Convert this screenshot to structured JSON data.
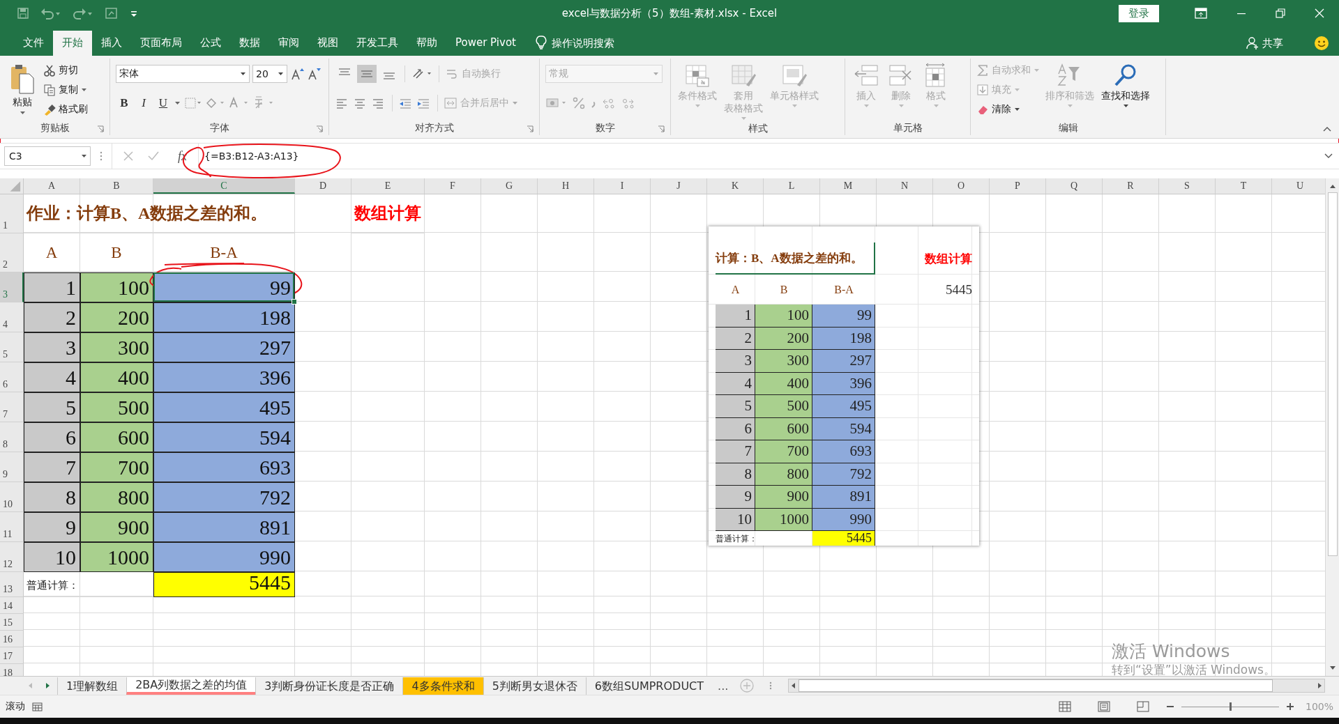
{
  "window": {
    "title": "excel与数据分析（5）数组-素材.xlsx  -  Excel",
    "sign_in": "登录"
  },
  "ribbon_tabs": [
    {
      "label": "文件",
      "selected": false
    },
    {
      "label": "开始",
      "selected": true
    },
    {
      "label": "插入",
      "selected": false
    },
    {
      "label": "页面布局",
      "selected": false
    },
    {
      "label": "公式",
      "selected": false
    },
    {
      "label": "数据",
      "selected": false
    },
    {
      "label": "审阅",
      "selected": false
    },
    {
      "label": "视图",
      "selected": false
    },
    {
      "label": "开发工具",
      "selected": false
    },
    {
      "label": "帮助",
      "selected": false
    },
    {
      "label": "Power Pivot",
      "selected": false
    }
  ],
  "tell_me": "操作说明搜索",
  "share": "共享",
  "ribbon": [
    {
      "kind": "clipboard",
      "label": "剪贴板",
      "paste": "粘贴",
      "commands": [
        {
          "label": "剪切",
          "disabled": false
        },
        {
          "label": "复制",
          "disabled": false
        },
        {
          "label": "格式刷",
          "disabled": false
        }
      ]
    },
    {
      "kind": "font",
      "label": "字体",
      "font_name": "宋体",
      "font_size": "20",
      "style_buttons": [
        {
          "label": "B"
        },
        {
          "label": "I"
        },
        {
          "label": "U"
        }
      ]
    },
    {
      "kind": "alignment",
      "label": "对齐方式",
      "vertical_align": [
        {
          "selected": false
        },
        {
          "selected": true
        },
        {
          "selected": false
        }
      ],
      "commands": [
        {
          "label": "自动换行",
          "disabled": true
        },
        {
          "label": "合并后居中",
          "disabled": true
        }
      ]
    },
    {
      "kind": "number",
      "label": "数字",
      "format": {
        "value": "常规",
        "disabled": true
      }
    },
    {
      "kind": "styles",
      "label": "样式",
      "commands": [
        {
          "label": "条件格式",
          "disabled": true
        },
        {
          "lines": [
            "套用",
            "表格格式"
          ],
          "disabled": true
        },
        {
          "label": "单元格样式",
          "disabled": true
        }
      ]
    },
    {
      "kind": "cells",
      "label": "单元格",
      "commands": [
        {
          "label": "插入",
          "disabled": true
        },
        {
          "label": "删除",
          "disabled": true
        },
        {
          "label": "格式",
          "disabled": true
        }
      ]
    },
    {
      "kind": "editing",
      "label": "编辑",
      "commands": [
        {
          "label": "自动求和",
          "disabled": true
        },
        {
          "label": "填充",
          "disabled": true
        },
        {
          "label": "清除",
          "disabled": false
        },
        {
          "label": "排序和筛选",
          "disabled": true
        },
        {
          "label": "查找和选择",
          "disabled": false
        }
      ]
    }
  ],
  "formula_bar": {
    "name_box": "C3",
    "function_label": "fx",
    "formula": "{=B3:B12-A3:A13}"
  },
  "columns": [
    {
      "label": "A",
      "selected": false
    },
    {
      "label": "B",
      "selected": false
    },
    {
      "label": "C",
      "selected": true
    },
    {
      "label": "D",
      "selected": false
    },
    {
      "label": "E",
      "selected": false
    },
    {
      "label": "F",
      "selected": false
    },
    {
      "label": "G",
      "selected": false
    },
    {
      "label": "H",
      "selected": false
    },
    {
      "label": "I",
      "selected": false
    },
    {
      "label": "J",
      "selected": false
    },
    {
      "label": "K",
      "selected": false
    },
    {
      "label": "L",
      "selected": false
    },
    {
      "label": "M",
      "selected": false
    },
    {
      "label": "N",
      "selected": false
    },
    {
      "label": "O",
      "selected": false
    },
    {
      "label": "P",
      "selected": false
    },
    {
      "label": "Q",
      "selected": false
    },
    {
      "label": "R",
      "selected": false
    },
    {
      "label": "S",
      "selected": false
    },
    {
      "label": "T",
      "selected": false
    },
    {
      "label": "U",
      "selected": false
    }
  ],
  "rows": [
    {
      "number": "1",
      "selected": false,
      "cells": [
        {
          "kind": "title",
          "text": "作业：计算B、A数据之差的和。",
          "selected": false
        },
        {
          "kind": "array-title",
          "text": "数组计算",
          "selected": false
        }
      ]
    },
    {
      "number": "2",
      "selected": false,
      "cells": [
        {
          "kind": "a-header",
          "text": "A",
          "selected": false
        },
        {
          "kind": "b-header",
          "text": "B",
          "selected": false
        },
        {
          "kind": "diff-header",
          "text": "B-A",
          "selected": false
        }
      ]
    },
    {
      "number": "3",
      "selected": true,
      "cells": [
        {
          "kind": "a-value",
          "text": "1",
          "color": "#c9c9c9",
          "selected": false
        },
        {
          "kind": "b-value",
          "text": "100",
          "color": "#a9d08e",
          "selected": false
        },
        {
          "kind": "diff-value",
          "text": "99",
          "color": "#8eaadb",
          "selected": true
        }
      ]
    },
    {
      "number": "4",
      "selected": false,
      "cells": [
        {
          "kind": "a-value",
          "text": "2",
          "color": "#c9c9c9",
          "selected": false
        },
        {
          "kind": "b-value",
          "text": "200",
          "color": "#a9d08e",
          "selected": false
        },
        {
          "kind": "diff-value",
          "text": "198",
          "color": "#8eaadb",
          "selected": false
        }
      ]
    },
    {
      "number": "5",
      "selected": false,
      "cells": [
        {
          "kind": "a-value",
          "text": "3",
          "color": "#c9c9c9",
          "selected": false
        },
        {
          "kind": "b-value",
          "text": "300",
          "color": "#a9d08e",
          "selected": false
        },
        {
          "kind": "diff-value",
          "text": "297",
          "color": "#8eaadb",
          "selected": false
        }
      ]
    },
    {
      "number": "6",
      "selected": false,
      "cells": [
        {
          "kind": "a-value",
          "text": "4",
          "color": "#c9c9c9",
          "selected": false
        },
        {
          "kind": "b-value",
          "text": "400",
          "color": "#a9d08e",
          "selected": false
        },
        {
          "kind": "diff-value",
          "text": "396",
          "color": "#8eaadb",
          "selected": false
        }
      ]
    },
    {
      "number": "7",
      "selected": false,
      "cells": [
        {
          "kind": "a-value",
          "text": "5",
          "color": "#c9c9c9",
          "selected": false
        },
        {
          "kind": "b-value",
          "text": "500",
          "color": "#a9d08e",
          "selected": false
        },
        {
          "kind": "diff-value",
          "text": "495",
          "color": "#8eaadb",
          "selected": false
        }
      ]
    },
    {
      "number": "8",
      "selected": false,
      "cells": [
        {
          "kind": "a-value",
          "text": "6",
          "color": "#c9c9c9",
          "selected": false
        },
        {
          "kind": "b-value",
          "text": "600",
          "color": "#a9d08e",
          "selected": false
        },
        {
          "kind": "diff-value",
          "text": "594",
          "color": "#8eaadb",
          "selected": false
        }
      ]
    },
    {
      "number": "9",
      "selected": false,
      "cells": [
        {
          "kind": "a-value",
          "text": "7",
          "color": "#c9c9c9",
          "selected": false
        },
        {
          "kind": "b-value",
          "text": "700",
          "color": "#a9d08e",
          "selected": false
        },
        {
          "kind": "diff-value",
          "text": "693",
          "color": "#8eaadb",
          "selected": false
        }
      ]
    },
    {
      "number": "10",
      "selected": false,
      "cells": [
        {
          "kind": "a-value",
          "text": "8",
          "color": "#c9c9c9",
          "selected": false
        },
        {
          "kind": "b-value",
          "text": "800",
          "color": "#a9d08e",
          "selected": false
        },
        {
          "kind": "diff-value",
          "text": "792",
          "color": "#8eaadb",
          "selected": false
        }
      ]
    },
    {
      "number": "11",
      "selected": false,
      "cells": [
        {
          "kind": "a-value",
          "text": "9",
          "color": "#c9c9c9",
          "selected": false
        },
        {
          "kind": "b-value",
          "text": "900",
          "color": "#a9d08e",
          "selected": false
        },
        {
          "kind": "diff-value",
          "text": "891",
          "color": "#8eaadb",
          "selected": false
        }
      ]
    },
    {
      "number": "12",
      "selected": false,
      "cells": [
        {
          "kind": "a-value",
          "text": "10",
          "color": "#c9c9c9",
          "selected": false
        },
        {
          "kind": "b-value",
          "text": "1000",
          "color": "#a9d08e",
          "selected": false
        },
        {
          "kind": "diff-value",
          "text": "990",
          "color": "#8eaadb",
          "selected": false
        }
      ]
    },
    {
      "number": "13",
      "selected": false,
      "cells": [
        {
          "kind": "note",
          "text": "普通计算：",
          "selected": false
        },
        {
          "kind": "total",
          "text": "5445",
          "color": "#ffff00",
          "selected": false
        }
      ]
    },
    {
      "number": "14",
      "selected": false
    },
    {
      "number": "15",
      "selected": false
    },
    {
      "number": "16",
      "selected": false
    },
    {
      "number": "17",
      "selected": false
    },
    {
      "number": "18",
      "selected": false
    }
  ],
  "pasted_picture": {
    "title": "计算：B、A数据之差的和。",
    "array_title": "数组计算",
    "headers": [
      "A",
      "B",
      "B-A"
    ],
    "array_result": "5445",
    "rows": [
      {
        "a": "1",
        "b": "100",
        "diff": "99"
      },
      {
        "a": "2",
        "b": "200",
        "diff": "198"
      },
      {
        "a": "3",
        "b": "300",
        "diff": "297"
      },
      {
        "a": "4",
        "b": "400",
        "diff": "396"
      },
      {
        "a": "5",
        "b": "500",
        "diff": "495"
      },
      {
        "a": "6",
        "b": "600",
        "diff": "594"
      },
      {
        "a": "7",
        "b": "700",
        "diff": "693"
      },
      {
        "a": "8",
        "b": "800",
        "diff": "792"
      },
      {
        "a": "9",
        "b": "900",
        "diff": "891"
      },
      {
        "a": "10",
        "b": "1000",
        "diff": "990"
      }
    ],
    "note": "普通计算：",
    "total": "5445"
  },
  "sheet_tabs": [
    {
      "label": "1理解数组",
      "selected": false
    },
    {
      "label": "2BA列数据之差的均值",
      "selected": true,
      "color": "#ff8080"
    },
    {
      "label": "3判断身份证长度是否正确",
      "selected": false
    },
    {
      "label": "4多条件求和",
      "selected": false,
      "color": "#ffc000"
    },
    {
      "label": "5判断男女退休否",
      "selected": false
    },
    {
      "label": "6数组SUMPRODUCT",
      "selected": false
    }
  ],
  "more_tabs": "...",
  "status_bar": {
    "mode": "滚动",
    "zoom": {
      "level": 0.5,
      "reading": "100%"
    }
  },
  "activation_notice": {
    "title": "激活 Windows",
    "message": "转到“设置”以激活 Windows。"
  }
}
